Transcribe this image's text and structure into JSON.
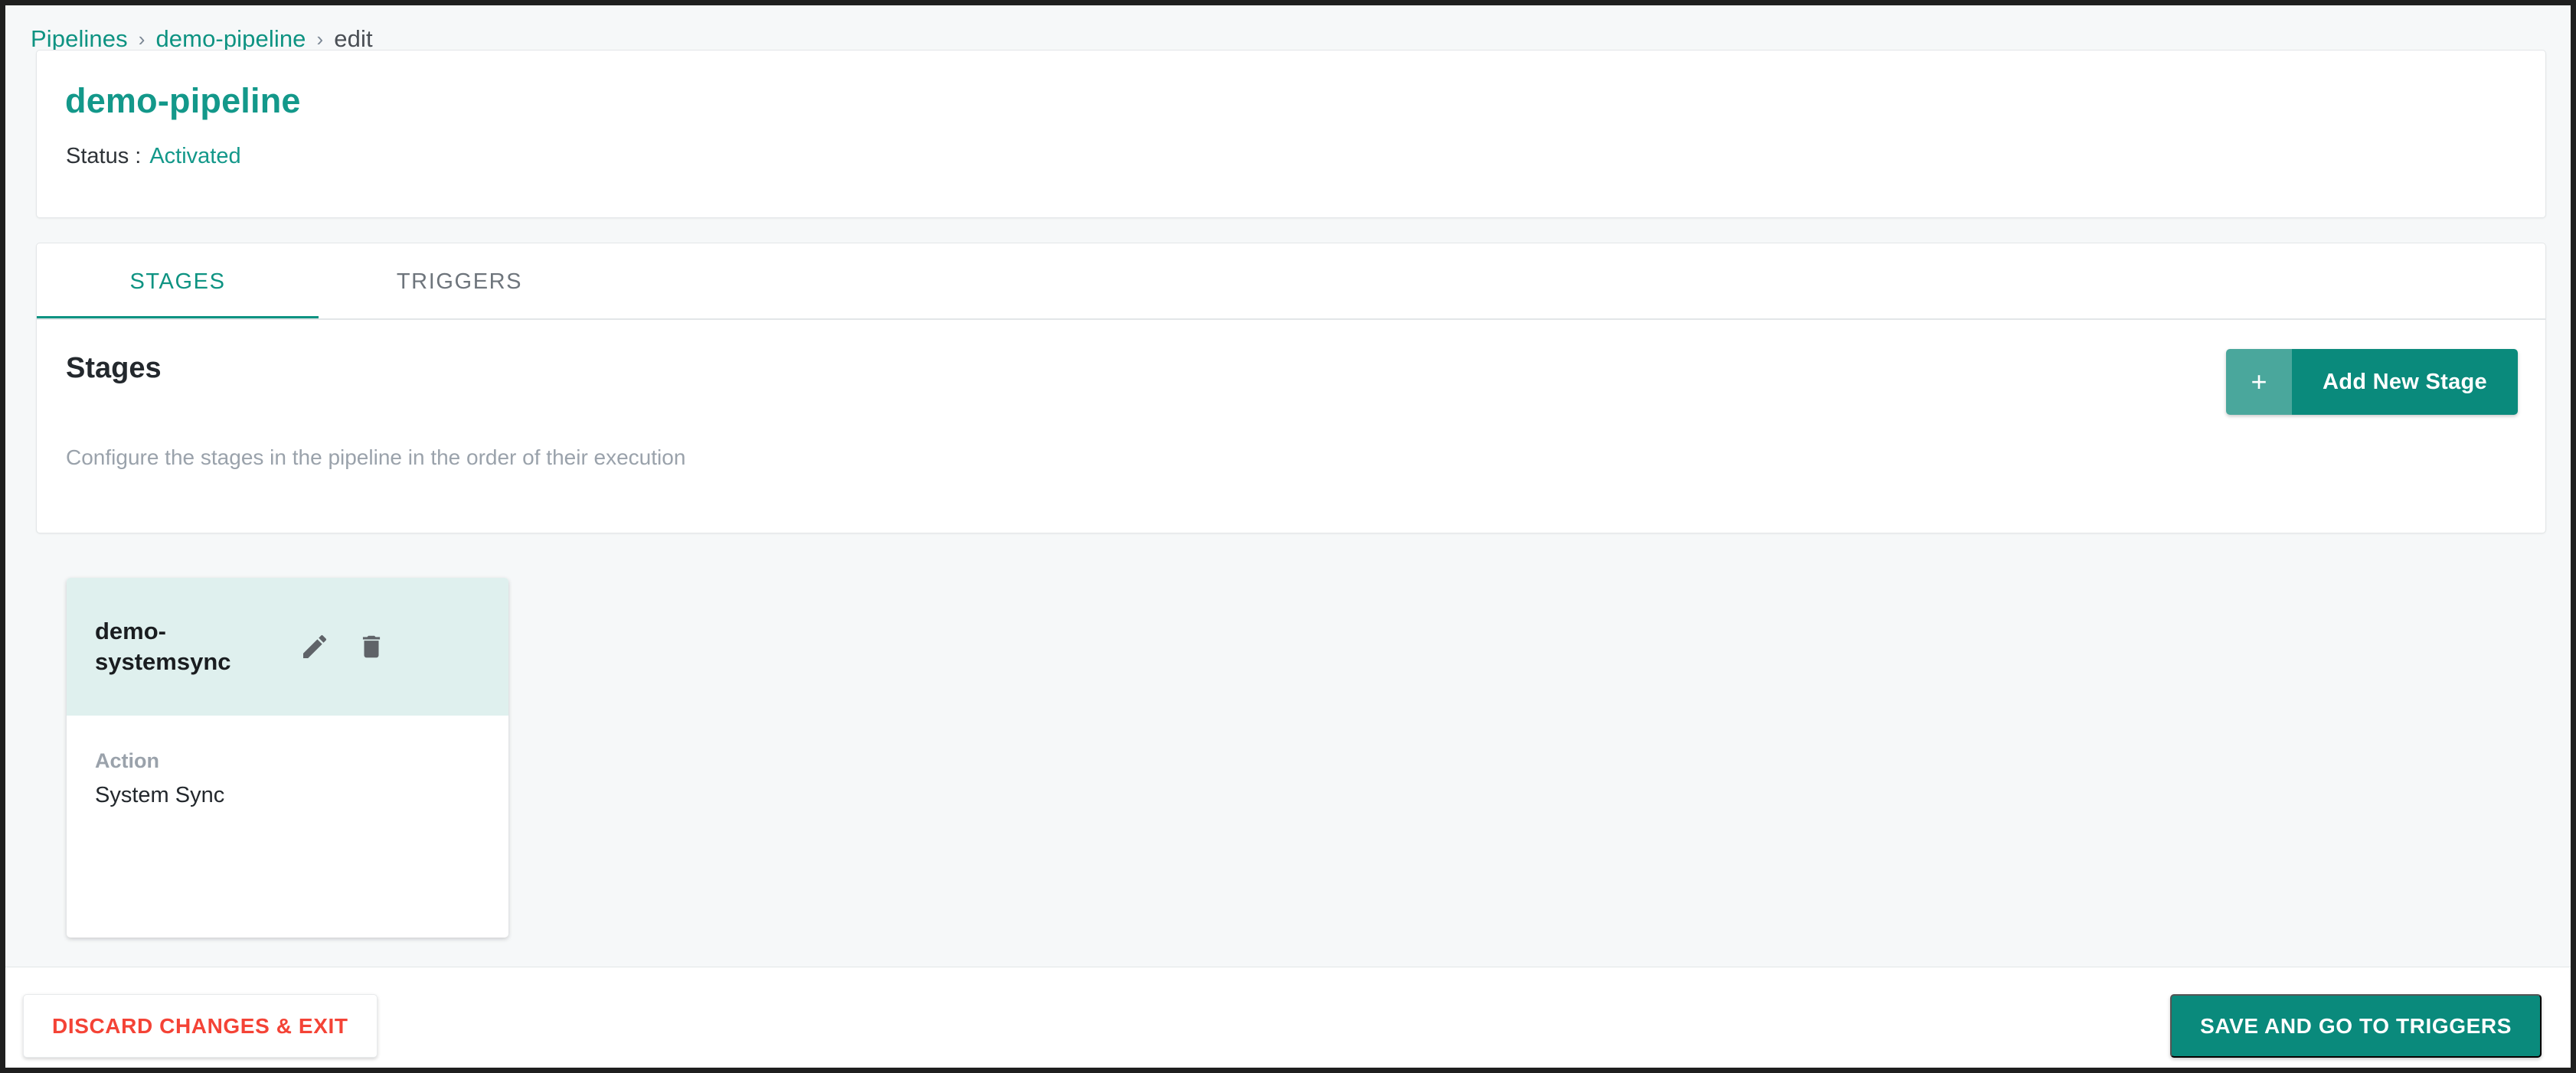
{
  "breadcrumb": {
    "items": [
      {
        "label": "Pipelines",
        "current": false
      },
      {
        "label": "demo-pipeline",
        "current": false
      },
      {
        "label": "edit",
        "current": true
      }
    ],
    "separator": "›"
  },
  "header": {
    "title": "demo-pipeline",
    "status_label": "Status :",
    "status_value": "Activated"
  },
  "tabs": [
    {
      "label": "STAGES",
      "active": true
    },
    {
      "label": "TRIGGERS",
      "active": false
    }
  ],
  "stages_section": {
    "heading": "Stages",
    "description": "Configure the stages in the pipeline in the order of their execution",
    "add_button": {
      "plus_glyph": "+",
      "label": "Add New Stage",
      "icon": "plus-icon"
    }
  },
  "stage_cards": [
    {
      "name": "demo-systemsync",
      "edit_icon": "pencil-icon",
      "delete_icon": "trash-icon",
      "fields": [
        {
          "label": "Action",
          "value": "System Sync"
        }
      ]
    }
  ],
  "footer": {
    "discard_label": "DISCARD CHANGES & EXIT",
    "save_label": "SAVE AND GO TO TRIGGERS"
  },
  "colors": {
    "accent_teal": "#0a8a7c",
    "link_teal": "#0e9382",
    "card_header_mint": "#dff0ee",
    "danger_red": "#f44336",
    "page_background": "#f6f8f9",
    "muted_text": "#9aa2ab"
  }
}
